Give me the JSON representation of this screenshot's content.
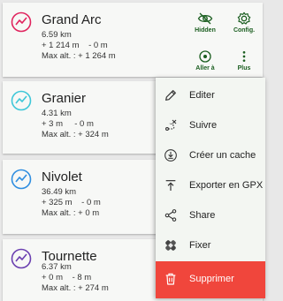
{
  "colors": {
    "accent_green": "#1b5e20",
    "danger": "#f0463c",
    "trail_icons": [
      "#e0245e",
      "#3ec7d8",
      "#2f8ee0",
      "#6a3fb0"
    ]
  },
  "trails": [
    {
      "name": "Grand Arc",
      "distance": "6.59 km",
      "gain_loss": "+ 1 214 m    - 0 m",
      "max_alt": "Max alt. : + 1 264 m",
      "icon": "trail-icon"
    },
    {
      "name": "Granier",
      "distance": "4.31 km",
      "gain_loss": "+ 3 m     - 0 m",
      "max_alt": "Max alt. : + 324 m",
      "icon": "trail-icon"
    },
    {
      "name": "Nivolet",
      "distance": "36.49 km",
      "gain_loss": "+ 325 m    - 0 m",
      "max_alt": "Max alt. : + 0 m",
      "icon": "trail-icon"
    },
    {
      "name": "Tournette",
      "distance": "6.37 km",
      "gain_loss": "+ 0 m    - 8 m",
      "max_alt": "Max alt. : + 274 m",
      "icon": "trail-icon"
    }
  ],
  "actions": {
    "hidden": "Hidden",
    "config": "Config.",
    "go_to": "Aller à",
    "more": "Plus"
  },
  "menu": {
    "items": [
      {
        "label": "Editer",
        "icon": "pencil-icon"
      },
      {
        "label": "Suivre",
        "icon": "route-icon"
      },
      {
        "label": "Créer un cache",
        "icon": "download-circle-icon"
      },
      {
        "label": "Exporter en GPX",
        "icon": "upload-icon"
      },
      {
        "label": "Share",
        "icon": "share-icon"
      },
      {
        "label": "Fixer",
        "icon": "bandage-icon"
      },
      {
        "label": "Supprimer",
        "icon": "trash-icon"
      }
    ]
  }
}
